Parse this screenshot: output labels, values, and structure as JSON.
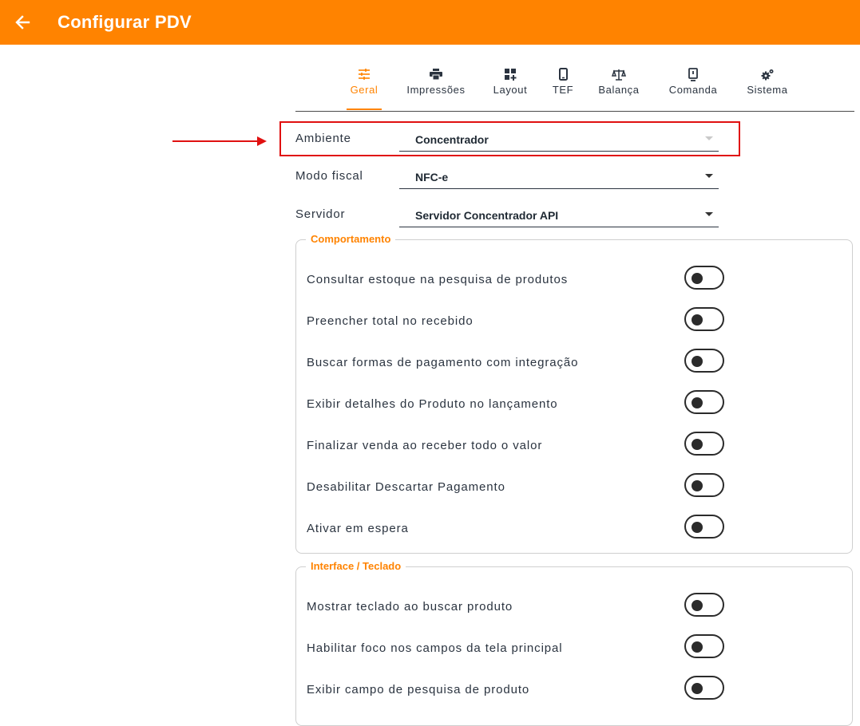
{
  "appbar": {
    "title": "Configurar PDV",
    "back_icon": "arrow-left-icon",
    "background": "#ff8300"
  },
  "tabs": [
    {
      "label": "Geral",
      "icon": "sliders-icon",
      "active": true
    },
    {
      "label": "Impressões",
      "icon": "printer-icon",
      "active": false
    },
    {
      "label": "Layout",
      "icon": "grid-add-icon",
      "active": false
    },
    {
      "label": "TEF",
      "icon": "phone-icon",
      "active": false
    },
    {
      "label": "Balança",
      "icon": "scale-icon",
      "active": false
    },
    {
      "label": "Comanda",
      "icon": "tablet-icon",
      "active": false
    },
    {
      "label": "Sistema",
      "icon": "gears-icon",
      "active": false
    }
  ],
  "fields": {
    "ambiente": {
      "label": "Ambiente",
      "value": "Concentrador"
    },
    "modo_fiscal": {
      "label": "Modo fiscal",
      "value": "NFC-e"
    },
    "servidor": {
      "label": "Servidor",
      "value": "Servidor Concentrador API"
    }
  },
  "comportamento": {
    "title": "Comportamento",
    "options": [
      {
        "label": "Consultar estoque na pesquisa de produtos",
        "enabled": false
      },
      {
        "label": "Preencher total no recebido",
        "enabled": false
      },
      {
        "label": "Buscar formas de pagamento com integração",
        "enabled": false
      },
      {
        "label": "Exibir detalhes do Produto no lançamento",
        "enabled": false
      },
      {
        "label": "Finalizar venda ao receber todo o valor",
        "enabled": false
      },
      {
        "label": "Desabilitar Descartar Pagamento",
        "enabled": false
      },
      {
        "label": "Ativar em espera",
        "enabled": false
      }
    ]
  },
  "interface": {
    "title": "Interface / Teclado",
    "options": [
      {
        "label": "Mostrar teclado ao buscar produto",
        "enabled": false
      },
      {
        "label": "Habilitar foco nos campos da tela principal",
        "enabled": false
      },
      {
        "label": "Exibir campo de pesquisa de produto",
        "enabled": false
      }
    ]
  },
  "colors": {
    "accent": "#ff8300",
    "annotation": "#e01010",
    "text": "#2b3440"
  }
}
